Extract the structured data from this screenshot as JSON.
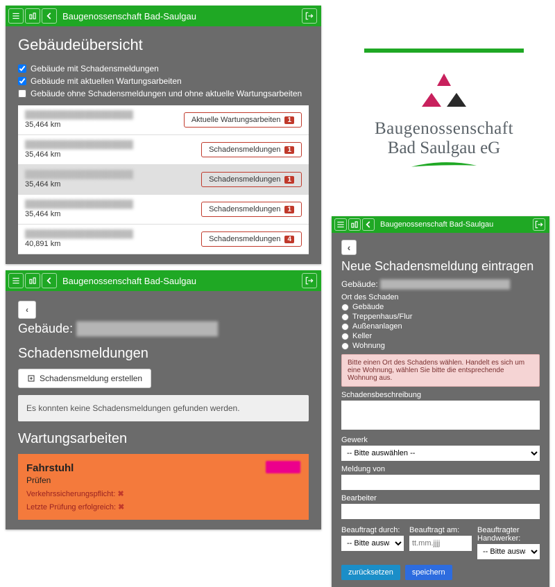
{
  "header": {
    "title": "Baugenossenschaft Bad-Saulgau"
  },
  "logo": {
    "line1": "Baugenossenschaft",
    "line2": "Bad Saulgau eG"
  },
  "panel1": {
    "title": "Gebäudeübersicht",
    "filters": {
      "a": "Gebäude mit Schadensmeldungen",
      "b": "Gebäude mit aktuellen Wartungsarbeiten",
      "c": "Gebäude ohne Schadensmeldungen und ohne aktuelle Wartungsarbeiten"
    },
    "rows": [
      {
        "title": "████████████████████",
        "dist": "35,464 km",
        "btn": "Aktuelle Wartungsarbeiten",
        "count": "1",
        "alt": false
      },
      {
        "title": "████████████████████",
        "dist": "35,464 km",
        "btn": "Schadensmeldungen",
        "count": "1",
        "alt": false
      },
      {
        "title": "████████████████████",
        "dist": "35,464 km",
        "btn": "Schadensmeldungen",
        "count": "1",
        "alt": true
      },
      {
        "title": "████████████████████",
        "dist": "35,464 km",
        "btn": "Schadensmeldungen",
        "count": "1",
        "alt": false
      },
      {
        "title": "████████████████████",
        "dist": "40,891 km",
        "btn": "Schadensmeldungen",
        "count": "4",
        "alt": false
      }
    ]
  },
  "panel2": {
    "building_label": "Gebäude:",
    "sec1": "Schadensmeldungen",
    "create": "Schadensmeldung erstellen",
    "empty": "Es konnten keine Schadensmeldungen gefunden werden.",
    "sec2": "Wartungsarbeiten",
    "maint": {
      "title": "Fahrstuhl",
      "sub": "Prüfen",
      "l1": "Verkehrssicherungspflicht:",
      "l2": "Letzte Prüfung erfolgreich:"
    }
  },
  "panel3": {
    "title": "Neue Schadensmeldung eintragen",
    "building_label": "Gebäude:",
    "loc_label": "Ort des Schaden",
    "opts": {
      "a": "Gebäude",
      "b": "Treppenhaus/Flur",
      "c": "Außenanlagen",
      "d": "Keller",
      "e": "Wohnung"
    },
    "warn": "Bitte einen Ort des Schadens wählen. Handelt es sich um eine Wohnung, wählen Sie bitte die entsprechende Wohnung aus.",
    "desc_label": "Schadensbeschreibung",
    "gewerk_label": "Gewerk",
    "gewerk_ph": "-- Bitte auswählen --",
    "meldung_label": "Meldung von",
    "bearbeiter_label": "Bearbeiter",
    "durch_label": "Beauftragt durch:",
    "durch_ph": "-- Bitte auswählen --",
    "am_label": "Beauftragt am:",
    "am_ph": "tt.mm.jjjj",
    "hw_label": "Beauftragter Handwerker:",
    "hw_ph": "-- Bitte auswählen --",
    "reset": "zurücksetzen",
    "save": "speichern"
  }
}
